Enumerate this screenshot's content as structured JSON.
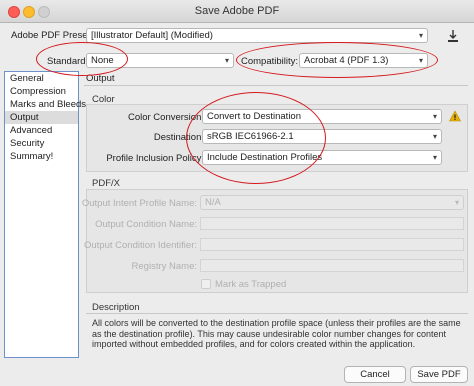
{
  "window": {
    "title": "Save Adobe PDF"
  },
  "preset": {
    "label": "Adobe PDF Preset:",
    "value": "[Illustrator Default] (Modified)"
  },
  "standard": {
    "label": "Standard:",
    "value": "None"
  },
  "compatibility": {
    "label": "Compatibility:",
    "value": "Acrobat 4 (PDF 1.3)"
  },
  "sidebar": {
    "items": [
      {
        "label": "General"
      },
      {
        "label": "Compression"
      },
      {
        "label": "Marks and Bleeds"
      },
      {
        "label": "Output"
      },
      {
        "label": "Advanced"
      },
      {
        "label": "Security"
      },
      {
        "label": "Summary!"
      }
    ]
  },
  "section": {
    "title": "Output"
  },
  "color": {
    "group_title": "Color",
    "conversion_label": "Color Conversion:",
    "conversion_value": "Convert to Destination",
    "destination_label": "Destination:",
    "destination_value": "sRGB IEC61966-2.1",
    "profile_label": "Profile Inclusion Policy:",
    "profile_value": "Include Destination Profiles"
  },
  "pdfx": {
    "group_title": "PDF/X",
    "intent_label": "Output Intent Profile Name:",
    "intent_value": "N/A",
    "condition_name_label": "Output Condition Name:",
    "condition_id_label": "Output Condition Identifier:",
    "registry_label": "Registry Name:",
    "trapped_label": "Mark as Trapped"
  },
  "description": {
    "title": "Description",
    "text": "All colors will be converted to the destination profile space (unless their profiles are the same as the destination profile). This may cause undesirable color number changes for content imported without embedded profiles, and for colors created within the application."
  },
  "buttons": {
    "cancel": "Cancel",
    "save": "Save PDF"
  },
  "colors": {
    "annotation": "#d3191e",
    "sidebar_border": "#6f91c9",
    "warning": "#e8b000"
  },
  "icons": [
    "save-preset-icon",
    "chevron-down-icon",
    "warning-icon"
  ]
}
